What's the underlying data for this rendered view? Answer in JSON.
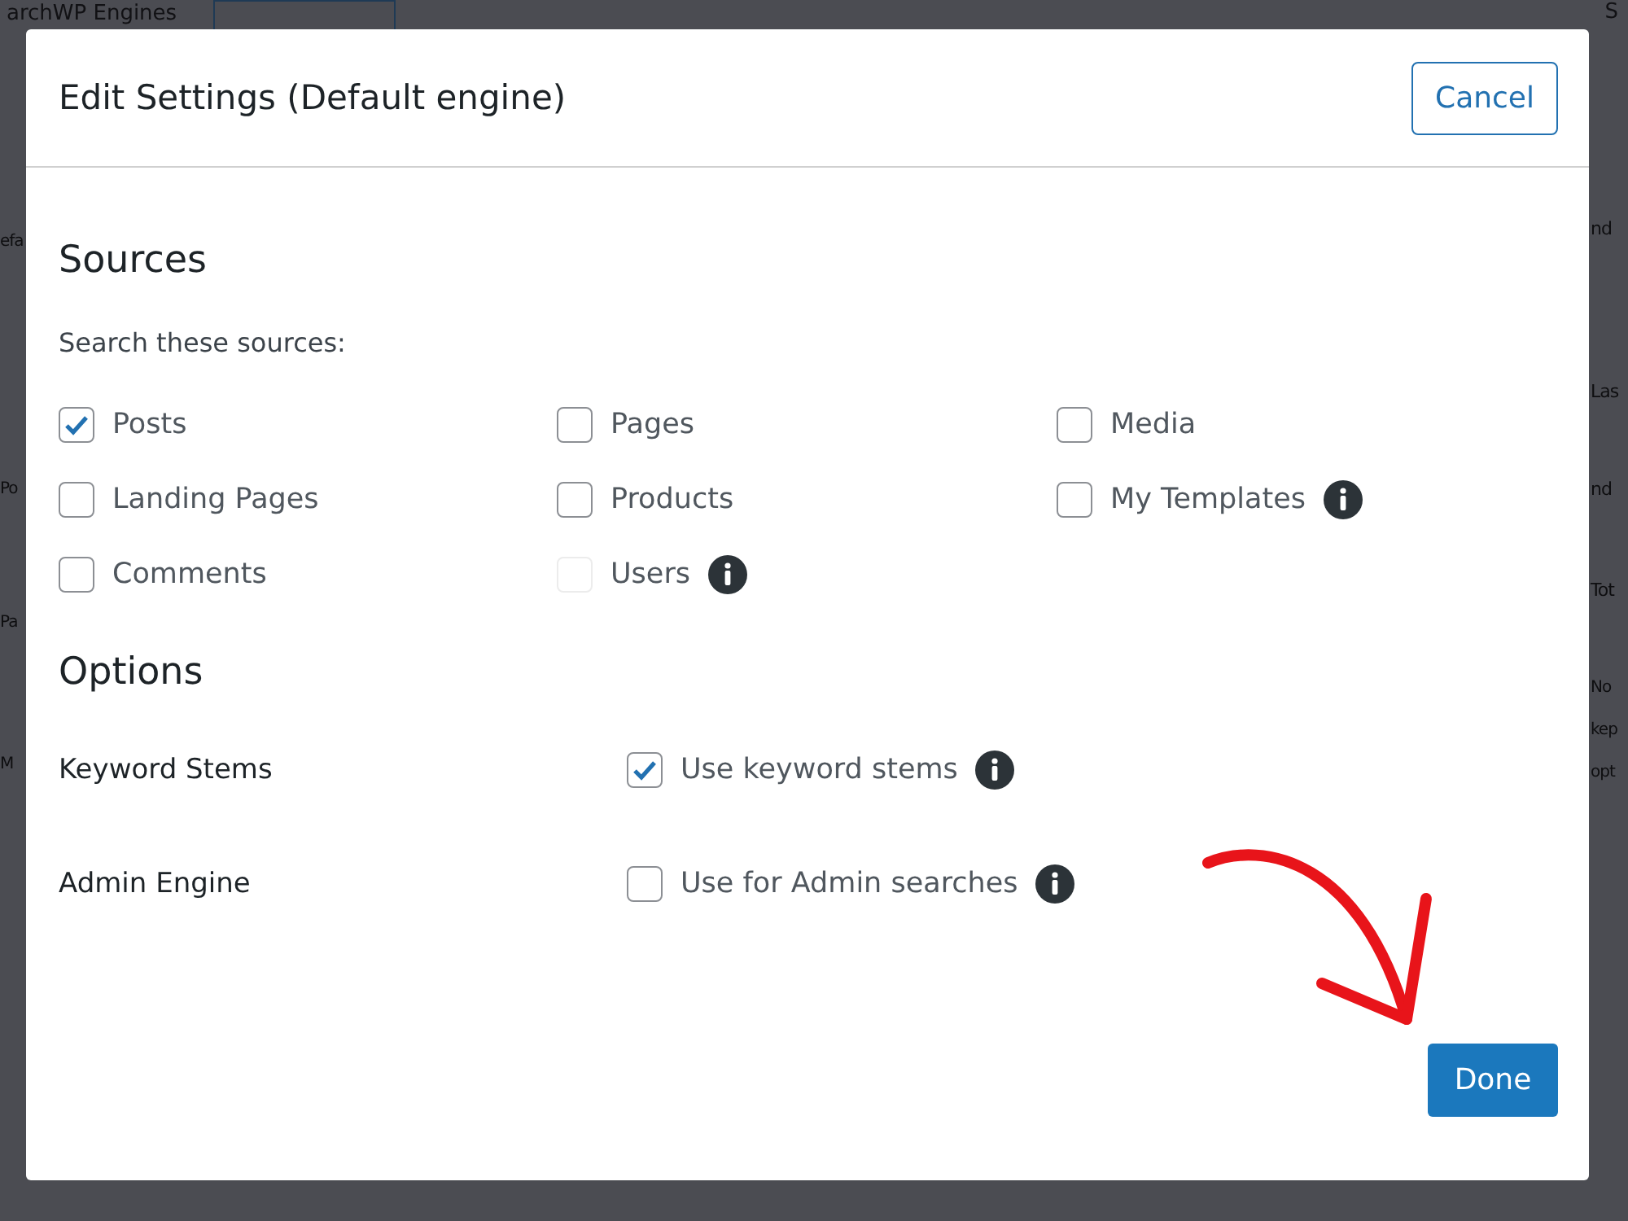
{
  "backdrop": {
    "heading": "archWP Engines",
    "corner": "S",
    "left": [
      "efa",
      "Po",
      "Pa",
      "M"
    ],
    "right": [
      "nd",
      "Las",
      "nd",
      "Tot",
      "No",
      "kep",
      "opt"
    ]
  },
  "dialog": {
    "title": "Edit Settings (Default engine)",
    "cancel": "Cancel",
    "done": "Done",
    "sources": {
      "heading": "Sources",
      "prompt": "Search these sources:",
      "items": [
        {
          "label": "Posts",
          "checked": true,
          "disabled": false,
          "info": false
        },
        {
          "label": "Pages",
          "checked": false,
          "disabled": false,
          "info": false
        },
        {
          "label": "Media",
          "checked": false,
          "disabled": false,
          "info": false
        },
        {
          "label": "Landing Pages",
          "checked": false,
          "disabled": false,
          "info": false
        },
        {
          "label": "Products",
          "checked": false,
          "disabled": false,
          "info": false
        },
        {
          "label": "My Templates",
          "checked": false,
          "disabled": false,
          "info": true
        },
        {
          "label": "Comments",
          "checked": false,
          "disabled": false,
          "info": false
        },
        {
          "label": "Users",
          "checked": false,
          "disabled": true,
          "info": true
        }
      ]
    },
    "options": {
      "heading": "Options",
      "rows": [
        {
          "name": "Keyword Stems",
          "label": "Use keyword stems",
          "checked": true,
          "info": true
        },
        {
          "name": "Admin Engine",
          "label": "Use for Admin searches",
          "checked": false,
          "info": true
        }
      ]
    }
  }
}
